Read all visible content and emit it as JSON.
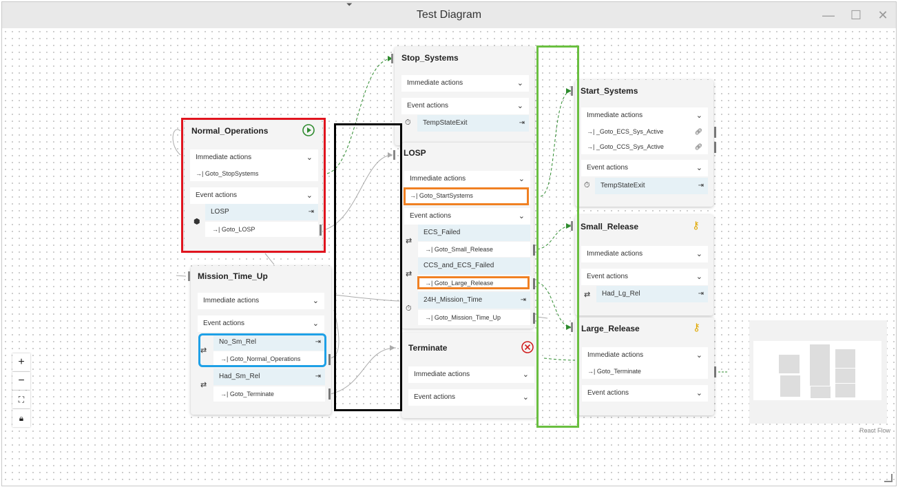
{
  "window": {
    "title": "Test Diagram",
    "minimize_icon": "minimize-icon",
    "maximize_icon": "maximize-icon",
    "close_icon": "close-icon"
  },
  "colors": {
    "highlight_red": "#e0141e",
    "highlight_black": "#000000",
    "highlight_orange": "#f08022",
    "highlight_green": "#6abf40",
    "highlight_blue": "#1ea0e6",
    "edge_green": "#2e8b2e",
    "start_green": "#2e8b2e",
    "terminate_red": "#d01c1c",
    "key_gold": "#e0a800"
  },
  "nodes": {
    "normal_operations": {
      "title": "Normal_Operations",
      "immediate_label": "Immediate actions",
      "immediate_rows": [
        "Goto_StopSystems"
      ],
      "event_label": "Event actions",
      "events": [
        {
          "name": "LOSP",
          "action": "Goto_LOSP"
        }
      ]
    },
    "mission_time_up": {
      "title": "Mission_Time_Up",
      "immediate_label": "Immediate actions",
      "event_label": "Event actions",
      "events": [
        {
          "name": "No_Sm_Rel",
          "action": "Goto_Normal_Operations"
        },
        {
          "name": "Had_Sm_Rel",
          "action": "Goto_Terminate"
        }
      ]
    },
    "stop_systems": {
      "title": "Stop_Systems",
      "immediate_label": "Immediate actions",
      "event_label": "Event actions",
      "events": [
        {
          "name": "TempStateExit"
        }
      ]
    },
    "losp": {
      "title": "LOSP",
      "immediate_label": "Immediate actions",
      "immediate_rows": [
        "Goto_StartSystems"
      ],
      "event_label": "Event actions",
      "events": [
        {
          "name": "ECS_Failed",
          "action": "Goto_Small_Release"
        },
        {
          "name": "CCS_and_ECS_Failed",
          "action": "Goto_Large_Release"
        },
        {
          "name": "24H_Mission_Time",
          "action": "Goto_Mission_Time_Up"
        }
      ]
    },
    "terminate": {
      "title": "Terminate",
      "immediate_label": "Immediate actions",
      "event_label": "Event actions"
    },
    "start_systems": {
      "title": "Start_Systems",
      "immediate_label": "Immediate actions",
      "immediate_rows": [
        "_Goto_ECS_Sys_Active",
        "_Goto_CCS_Sys_Active"
      ],
      "event_label": "Event actions",
      "events": [
        {
          "name": "TempStateExit"
        }
      ]
    },
    "small_release": {
      "title": "Small_Release",
      "immediate_label": "Immediate actions",
      "event_label": "Event actions",
      "events": [
        {
          "name": "Had_Lg_Rel"
        }
      ]
    },
    "large_release": {
      "title": "Large_Release",
      "immediate_label": "Immediate actions",
      "immediate_rows": [
        "Goto_Terminate"
      ],
      "event_label": "Event actions"
    }
  },
  "controls": {
    "zoom_in": "+",
    "zoom_out": "−",
    "fit_view_icon": "fit-view-icon",
    "lock_icon": "lock-icon"
  },
  "attribution": "React Flow"
}
